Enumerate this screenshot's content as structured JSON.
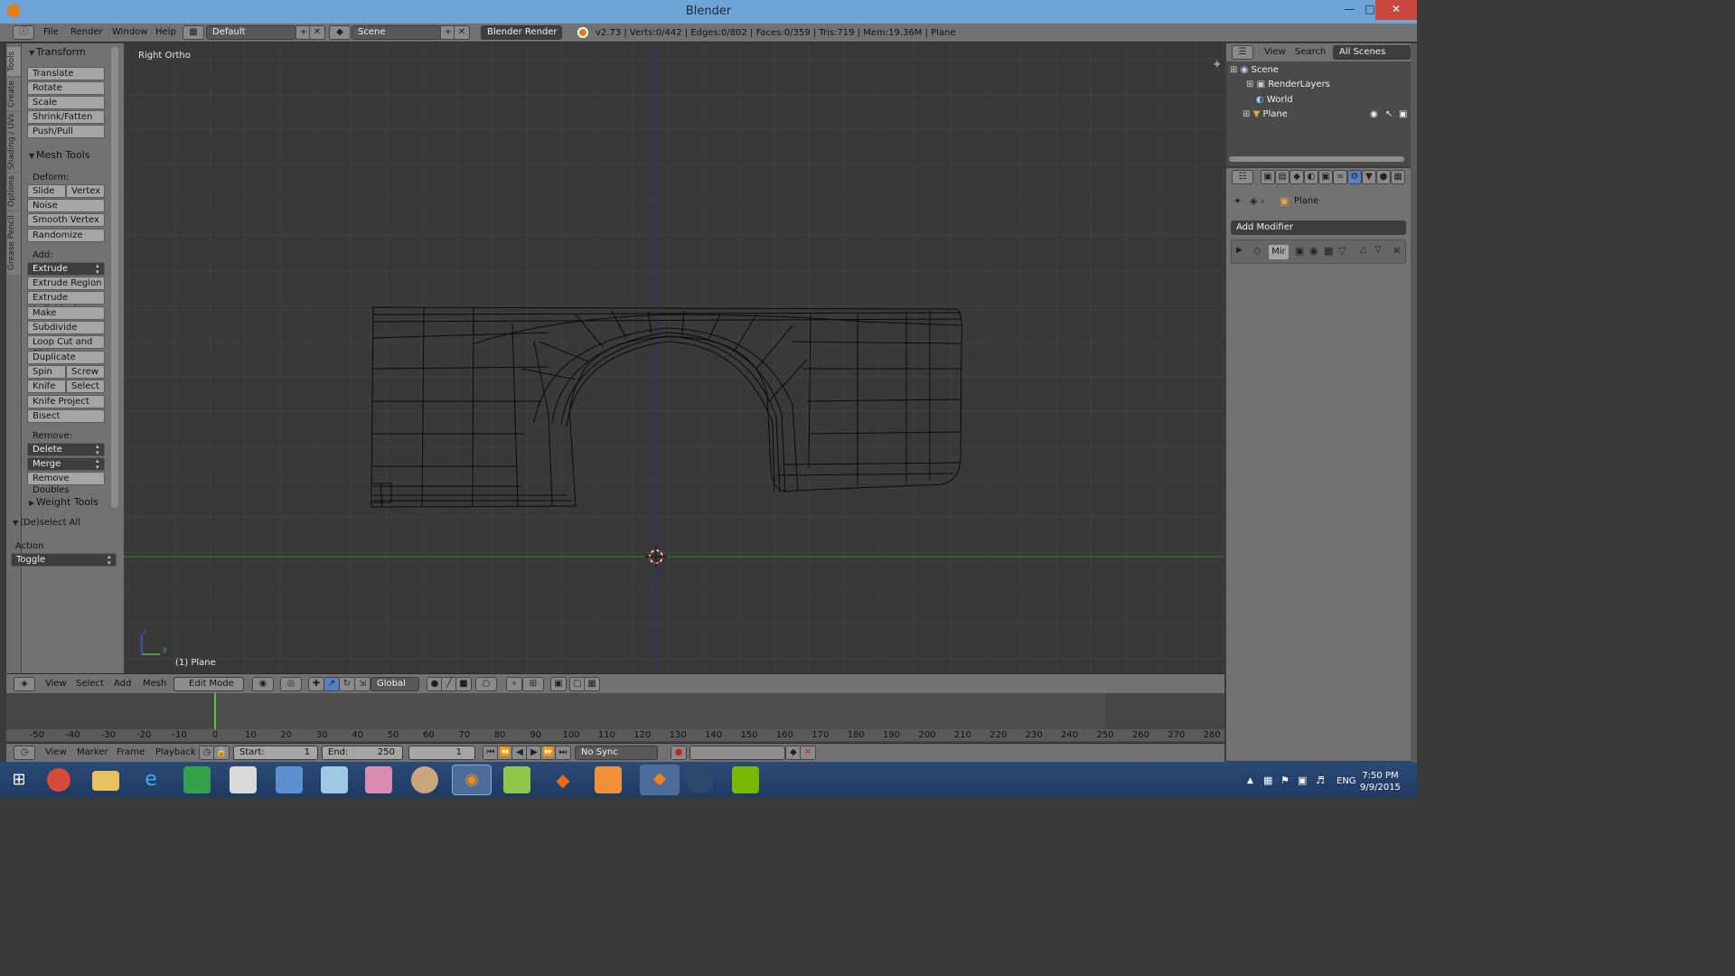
{
  "window": {
    "title": "Blender"
  },
  "top_menu": [
    "File",
    "Render",
    "Window",
    "Help"
  ],
  "layout_field": "Default",
  "scene_field": "Scene",
  "engine_field": "Blender Render",
  "stats": "v2.73 | Verts:0/442 | Edges:0/802 | Faces:0/359 | Tris:719 | Mem:19.36M | Plane",
  "tool_tabs": [
    "Tools",
    "Create",
    "Shading / UVs",
    "Options",
    "Grease Pencil"
  ],
  "toolshelf": {
    "transform": {
      "header": "Transform",
      "buttons": [
        "Translate",
        "Rotate",
        "Scale",
        "Shrink/Fatten",
        "Push/Pull"
      ]
    },
    "mesh_tools": {
      "header": "Mesh Tools",
      "deform_label": "Deform:",
      "slide_edge": "Slide Ed",
      "vertex": "Vertex",
      "noise": "Noise",
      "smooth_vertex": "Smooth Vertex",
      "randomize": "Randomize",
      "add_label": "Add:",
      "extrude": "Extrude",
      "extrude_region": "Extrude Region",
      "extrude_individual": "Extrude Individual",
      "make_edge_face": "Make Edge/Face",
      "subdivide": "Subdivide",
      "loop_cut": "Loop Cut and Slide",
      "duplicate": "Duplicate",
      "spin": "Spin",
      "screw": "Screw",
      "knife": "Knife",
      "select": "Select",
      "knife_project": "Knife Project",
      "bisect": "Bisect",
      "remove_label": "Remove:",
      "delete": "Delete",
      "merge": "Merge",
      "remove_doubles": "Remove Doubles"
    },
    "weight_tools": "Weight Tools",
    "operator": {
      "header": "(De)select All",
      "action_label": "Action",
      "action_value": "Toggle"
    }
  },
  "viewport": {
    "view_label": "Right Ortho",
    "object_label": "(1) Plane",
    "axis_y": "y",
    "axis_z": "z"
  },
  "viewport_header": {
    "menus": [
      "View",
      "Select",
      "Add",
      "Mesh"
    ],
    "mode": "Edit Mode",
    "orientation": "Global"
  },
  "timeline": {
    "ticks": [
      "-50",
      "-40",
      "-30",
      "-20",
      "-10",
      "0",
      "10",
      "20",
      "30",
      "40",
      "50",
      "60",
      "70",
      "80",
      "90",
      "100",
      "110",
      "120",
      "130",
      "140",
      "150",
      "160",
      "170",
      "180",
      "190",
      "200",
      "210",
      "220",
      "230",
      "240",
      "250",
      "260",
      "270",
      "280"
    ],
    "menus": [
      "View",
      "Marker",
      "Frame",
      "Playback"
    ],
    "start_label": "Start:",
    "start_value": "1",
    "end_label": "End:",
    "end_value": "250",
    "current_frame": "1",
    "sync": "No Sync"
  },
  "outliner": {
    "menus": [
      "View",
      "Search"
    ],
    "filter": "All Scenes",
    "items": [
      "Scene",
      "RenderLayers",
      "World",
      "Plane"
    ]
  },
  "properties": {
    "object_name": "Plane",
    "add_modifier": "Add Modifier",
    "modifier_name": "Mir"
  },
  "taskbar": {
    "lang": "ENG",
    "time": "7:50 PM",
    "date": "9/9/2015"
  }
}
